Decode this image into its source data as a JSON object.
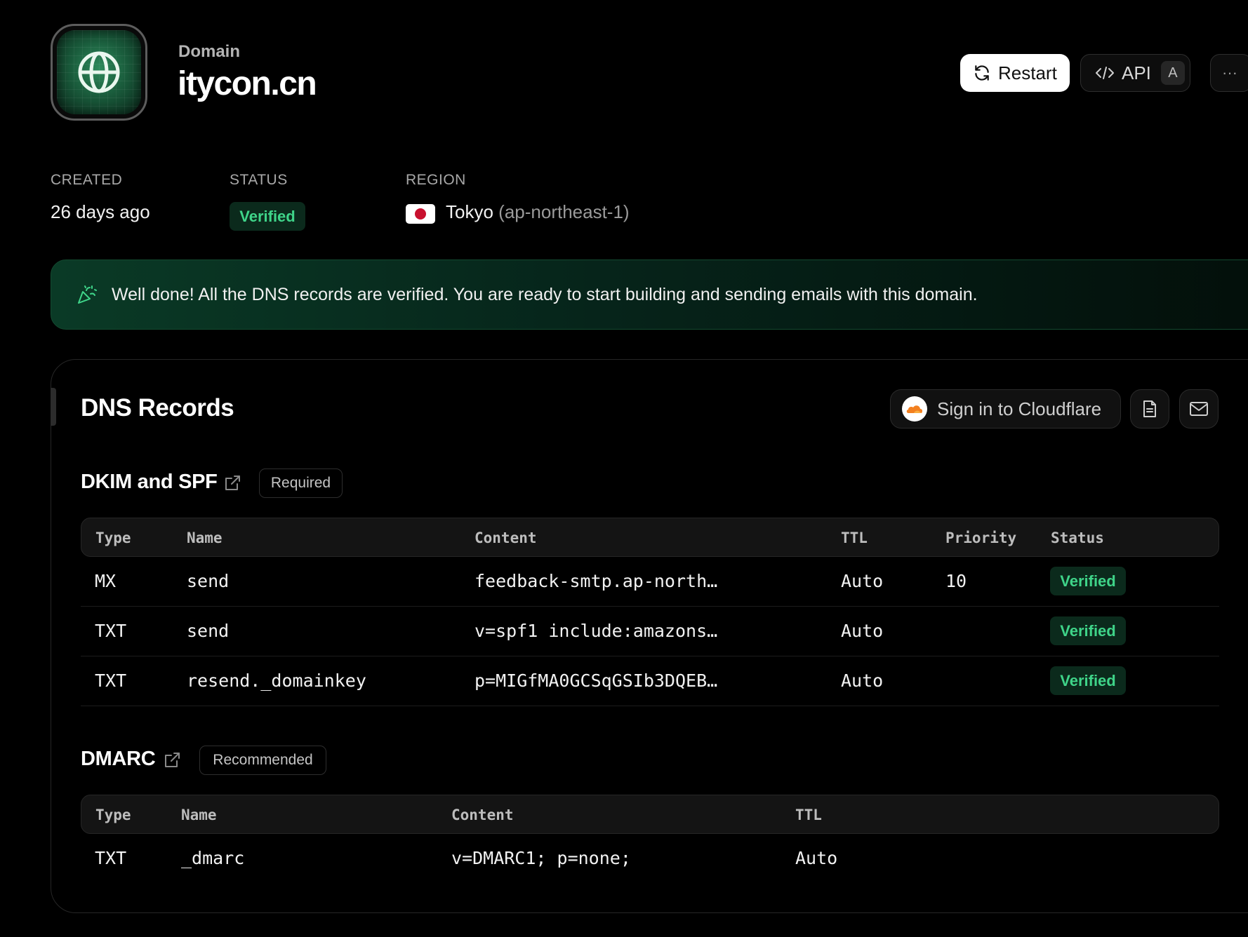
{
  "header": {
    "eyebrow": "Domain",
    "title": "itycon.cn",
    "logo_icon": "globe-icon",
    "buttons": {
      "restart": {
        "label": "Restart",
        "icon": "refresh-icon"
      },
      "api": {
        "label": "API",
        "icon": "code-icon",
        "shortcut": "A"
      },
      "more": {
        "label": "···",
        "icon": "more-icon"
      }
    }
  },
  "meta": {
    "created": {
      "label": "CREATED",
      "value": "26 days ago"
    },
    "status": {
      "label": "STATUS",
      "value": "Verified"
    },
    "region": {
      "label": "REGION",
      "name": "Tokyo",
      "code": "(ap-northeast-1)",
      "flag_icon": "japan-flag-icon"
    }
  },
  "banner": {
    "icon": "party-popper-icon",
    "text": "Well done! All the DNS records are verified. You are ready to start building and sending emails with this domain."
  },
  "dns": {
    "title": "DNS Records",
    "cloudflare_button": {
      "label": "Sign in to Cloudflare",
      "icon": "cloudflare-icon"
    },
    "doc_button_icon": "document-icon",
    "mail_button_icon": "mail-icon",
    "sections": [
      {
        "title": "DKIM and SPF",
        "tag": "Required",
        "columns": [
          "Type",
          "Name",
          "Content",
          "TTL",
          "Priority",
          "Status"
        ],
        "rows": [
          {
            "type": "MX",
            "name": "send",
            "content": "feedback-smtp.ap-north…",
            "ttl": "Auto",
            "priority": "10",
            "status": "Verified"
          },
          {
            "type": "TXT",
            "name": "send",
            "content": "v=spf1 include:amazons…",
            "ttl": "Auto",
            "priority": "",
            "status": "Verified"
          },
          {
            "type": "TXT",
            "name": "resend._domainkey",
            "content": "p=MIGfMA0GCSqGSIb3DQEB…",
            "ttl": "Auto",
            "priority": "",
            "status": "Verified"
          }
        ]
      },
      {
        "title": "DMARC",
        "tag": "Recommended",
        "columns": [
          "Type",
          "Name",
          "Content",
          "TTL"
        ],
        "rows": [
          {
            "type": "TXT",
            "name": "_dmarc",
            "content": "v=DMARC1; p=none;",
            "ttl": "Auto"
          }
        ]
      }
    ]
  },
  "colors": {
    "background": "#000000",
    "success_text": "#3fd489",
    "success_bg": "#0b2a1c",
    "banner_bg": "#0a3a26"
  }
}
